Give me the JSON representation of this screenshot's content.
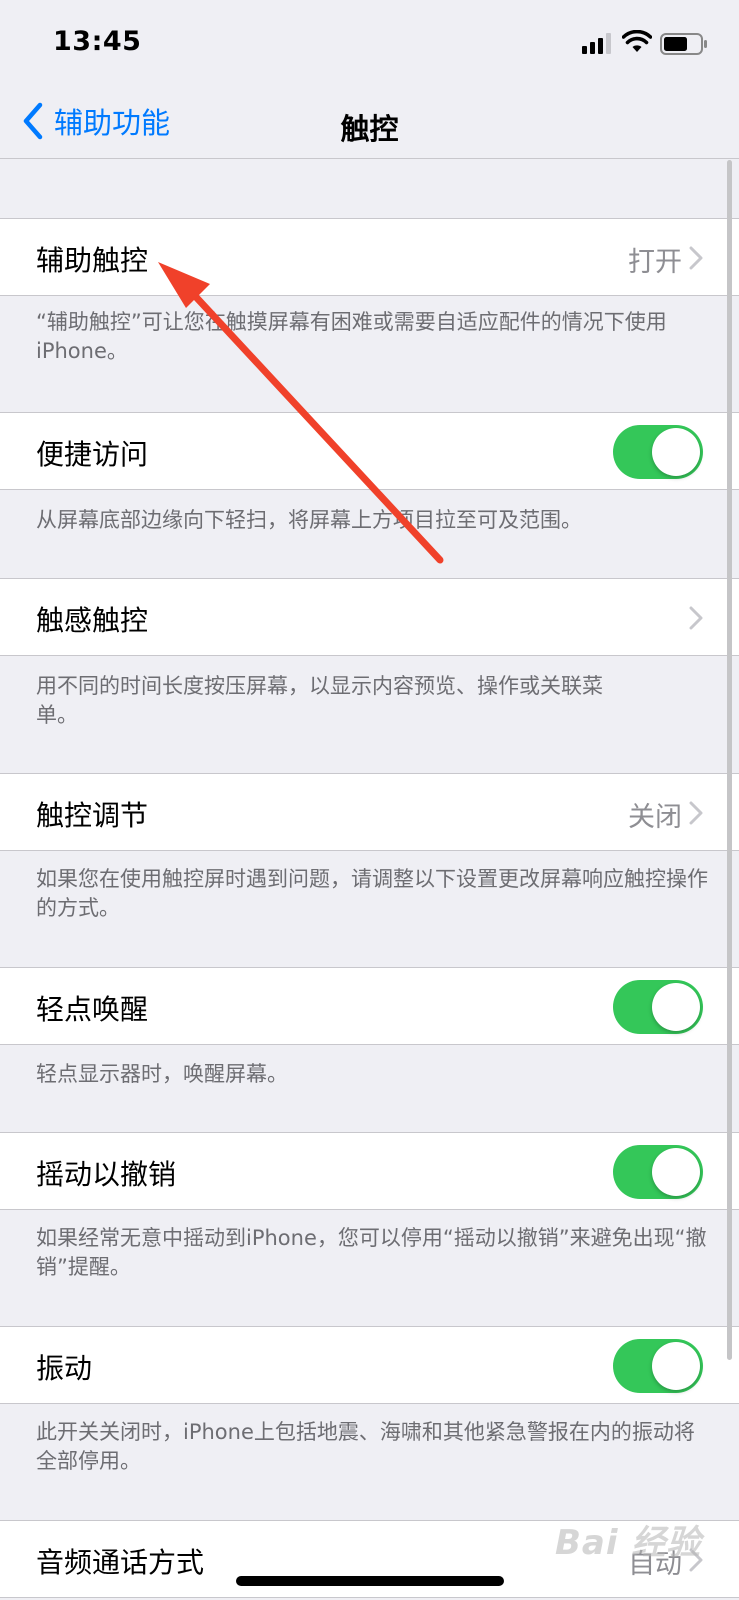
{
  "status_bar": {
    "time": "13:45"
  },
  "nav": {
    "back_label": "辅助功能",
    "title": "触控"
  },
  "sections": [
    {
      "label": "辅助触控",
      "detail": "打开",
      "control": "disclosure",
      "footer": "“辅助触控”可让您在触摸屏幕有困难或需要自适应配件的情况下使用iPhone。"
    },
    {
      "label": "便捷访问",
      "control": "toggle",
      "toggle_on": true,
      "footer": "从屏幕底部边缘向下轻扫，将屏幕上方项目拉至可及范围。"
    },
    {
      "label": "触感触控",
      "control": "disclosure",
      "footer": "用不同的时间长度按压屏幕，以显示内容预览、操作或关联菜单。"
    },
    {
      "label": "触控调节",
      "detail": "关闭",
      "control": "disclosure",
      "footer": "如果您在使用触控屏时遇到问题，请调整以下设置更改屏幕响应触控操作的方式。"
    },
    {
      "label": "轻点唤醒",
      "control": "toggle",
      "toggle_on": true,
      "footer": "轻点显示器时，唤醒屏幕。"
    },
    {
      "label": "摇动以撤销",
      "control": "toggle",
      "toggle_on": true,
      "footer": "如果经常无意中摇动到iPhone，您可以停用“摇动以撤销”来避免出现“撤销”提醒。"
    },
    {
      "label": "振动",
      "control": "toggle",
      "toggle_on": true,
      "footer": "此开关关闭时，iPhone上包括地震、海啸和其他紧急警报在内的振动将全部停用。"
    },
    {
      "label": "音频通话方式",
      "detail": "自动",
      "control": "disclosure"
    }
  ],
  "watermark": "Bai 经验",
  "colors": {
    "accent": "#007aff",
    "toggle_on": "#34c759",
    "annotation_arrow": "#f0412a"
  }
}
